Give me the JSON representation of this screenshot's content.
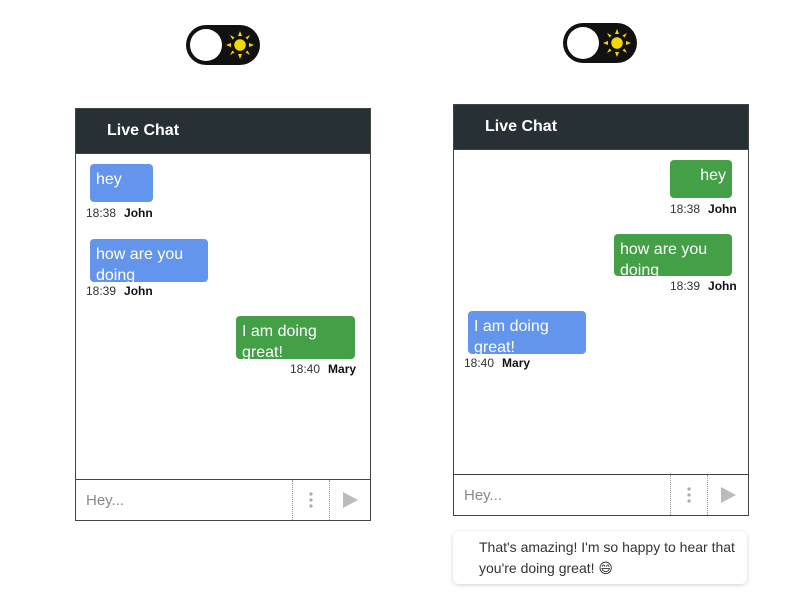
{
  "left_panel": {
    "toggle": {
      "icon": "sun-icon",
      "state": "off"
    },
    "chat": {
      "title": "Live Chat",
      "messages": [
        {
          "text": "hey",
          "time": "18:38",
          "author": "John",
          "color": "#6495ed"
        },
        {
          "text": "how are you doing",
          "time": "18:39",
          "author": "John",
          "color": "#6495ed"
        },
        {
          "text": "I am doing great!",
          "time": "18:40",
          "author": "Mary",
          "color": "#43a047"
        }
      ],
      "input_placeholder": "Hey..."
    }
  },
  "right_panel": {
    "toggle": {
      "icon": "sun-icon",
      "state": "off"
    },
    "chat": {
      "title": "Live Chat",
      "messages": [
        {
          "text": "hey",
          "time": "18:38",
          "author": "John",
          "color": "#43a047"
        },
        {
          "text": "how are you doing",
          "time": "18:39",
          "author": "John",
          "color": "#43a047"
        },
        {
          "text": "I am doing great!",
          "time": "18:40",
          "author": "Mary",
          "color": "#6495ed"
        }
      ],
      "input_placeholder": "Hey..."
    },
    "reply_suggestion": "That's amazing! I'm so happy to hear that you're doing great! 😄"
  }
}
